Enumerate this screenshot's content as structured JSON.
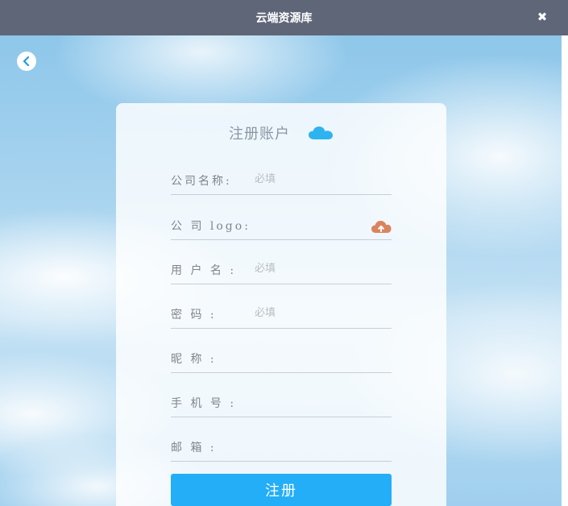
{
  "window": {
    "title": "云端资源库",
    "close_symbol": "✖"
  },
  "colors": {
    "titlebar": "#5e6678",
    "accent": "#23aef7",
    "cloud_icon": "#2fb3f0",
    "upload_icon": "#d9845f"
  },
  "form": {
    "title": "注册账户",
    "fields": [
      {
        "label": "公司名称:",
        "placeholder": "必填"
      },
      {
        "label": "公 司 logo:",
        "placeholder": ""
      },
      {
        "label": "用 户 名 :",
        "placeholder": "必填"
      },
      {
        "label": "密   码   :",
        "placeholder": "必填"
      },
      {
        "label": "昵   称   :",
        "placeholder": ""
      },
      {
        "label": "手 机 号 :",
        "placeholder": ""
      },
      {
        "label": "邮   箱   :",
        "placeholder": ""
      }
    ],
    "submit_label": "注册"
  },
  "icons": {
    "back": "chevron-left-icon",
    "title_cloud": "cloud-icon",
    "upload": "cloud-upload-icon"
  }
}
